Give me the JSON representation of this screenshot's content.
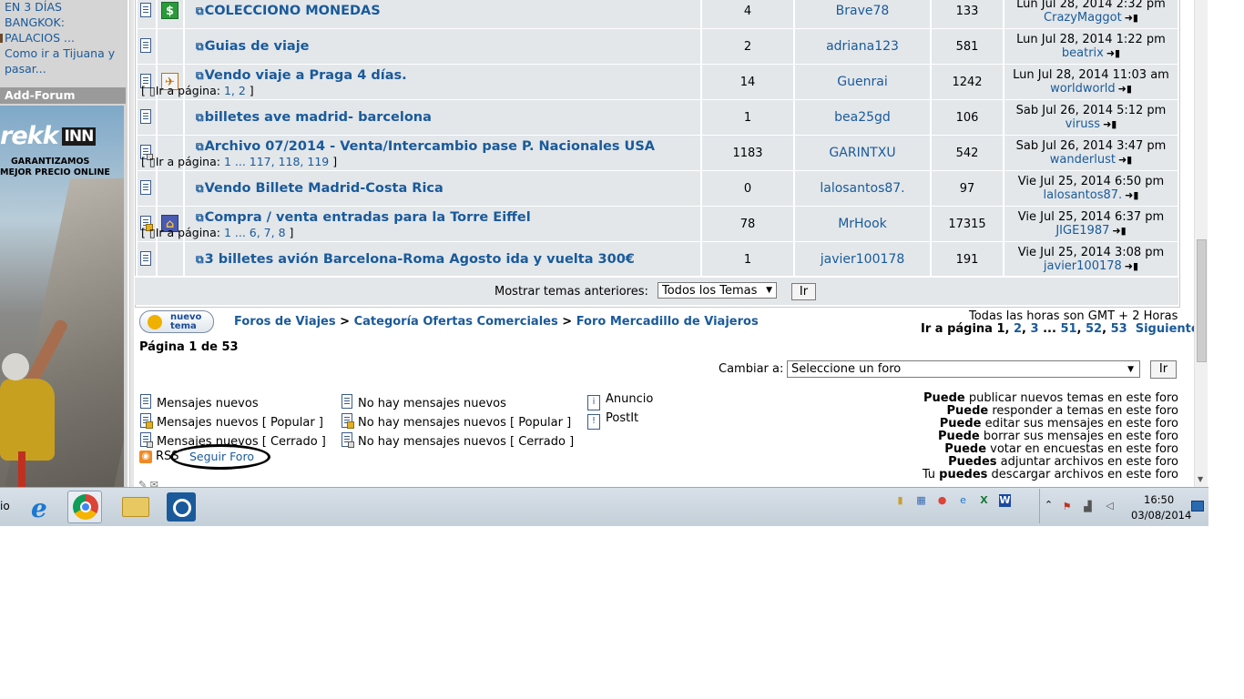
{
  "sidebar": {
    "links": [
      "EN 3 DÍAS",
      "BANGKOK:",
      "PALACIOS ...",
      "Como ir a Tijuana y",
      "pasar..."
    ],
    "section_title": "Add-Forum",
    "ad": {
      "brand": "rekk",
      "brand_box": "INN",
      "line1": "GARANTIZAMOS",
      "line2": "MEJOR PRECIO ONLINE"
    }
  },
  "topics": [
    {
      "title": "COLECCIONO MONEDAS",
      "pages_label": "",
      "pages": "",
      "replies": "4",
      "author": "Brave78",
      "views": "133",
      "last_date": "Lun Jul 28, 2014 2:32 pm",
      "last_user": "CrazyMaggot",
      "type_icon": "dollar-icon",
      "status_icon": "doc-icon"
    },
    {
      "title": "Guias de viaje",
      "pages_label": "",
      "pages": "",
      "replies": "2",
      "author": "adriana123",
      "views": "581",
      "last_date": "Lun Jul 28, 2014 1:22 pm",
      "last_user": "beatrix",
      "type_icon": "",
      "status_icon": "doc-icon"
    },
    {
      "title": "Vendo viaje a Praga 4 días.",
      "pages_label": "Ir a página:",
      "pages": "1, 2",
      "replies": "14",
      "author": "Guenrai",
      "views": "1242",
      "last_date": "Lun Jul 28, 2014 11:03 am",
      "last_user": "worldworld",
      "type_icon": "plane-icon",
      "status_icon": "doc-icon"
    },
    {
      "title": "billetes ave madrid- barcelona",
      "pages_label": "",
      "pages": "",
      "replies": "1",
      "author": "bea25gd",
      "views": "106",
      "last_date": "Sab Jul 26, 2014 5:12 pm",
      "last_user": "viruss",
      "type_icon": "",
      "status_icon": "doc-icon"
    },
    {
      "title": "Archivo 07/2014 - Venta/Intercambio pase P. Nacionales USA",
      "pages_label": "Ir a página:",
      "pages": "1 ... 117, 118, 119",
      "replies": "1183",
      "author": "GARINTXU",
      "views": "542",
      "last_date": "Sab Jul 26, 2014 3:47 pm",
      "last_user": "wanderlust",
      "type_icon": "",
      "status_icon": "doc-locked-icon"
    },
    {
      "title": "Vendo Billete Madrid-Costa Rica",
      "pages_label": "",
      "pages": "",
      "replies": "0",
      "author": "lalosantos87.",
      "views": "97",
      "last_date": "Vie Jul 25, 2014 6:50 pm",
      "last_user": "lalosantos87.",
      "type_icon": "",
      "status_icon": "doc-icon"
    },
    {
      "title": "Compra / venta entradas para la Torre Eiffel",
      "pages_label": "Ir a página:",
      "pages": "1 ... 6, 7, 8",
      "replies": "78",
      "author": "MrHook",
      "views": "17315",
      "last_date": "Vie Jul 25, 2014 6:37 pm",
      "last_user": "JIGE1987",
      "type_icon": "museum-icon",
      "status_icon": "doc-hot-icon"
    },
    {
      "title": "3 billetes avión Barcelona-Roma Agosto ida y vuelta 300€",
      "pages_label": "",
      "pages": "",
      "replies": "1",
      "author": "javier100178",
      "views": "191",
      "last_date": "Vie Jul 25, 2014 3:08 pm",
      "last_user": "javier100178",
      "type_icon": "",
      "status_icon": "doc-icon"
    }
  ],
  "table_footer": {
    "label": "Mostrar temas anteriores:",
    "select_value": "Todos los Temas",
    "button": "Ir"
  },
  "new_topic": {
    "line1": "nuevo",
    "line2": "tema"
  },
  "breadcrumb": {
    "items": [
      "Foros de Viajes",
      "Categoría Ofertas Comerciales",
      "Foro Mercadillo de Viajeros"
    ],
    "separator": ">"
  },
  "timezone": "Todas las horas son GMT + 2 Horas",
  "pagination": {
    "label": "Ir a página",
    "current": "1",
    "pages": [
      "2",
      "3",
      "...",
      "51",
      "52",
      "53"
    ],
    "next": "Siguiente"
  },
  "page_info": "Página 1 de 53",
  "jump": {
    "label": "Cambiar a:",
    "select_value": "Seleccione un foro",
    "button": "Ir"
  },
  "legend": {
    "col1": [
      "Mensajes nuevos",
      "Mensajes nuevos [ Popular ]",
      "Mensajes nuevos [ Cerrado ]"
    ],
    "col2": [
      "No hay mensajes nuevos",
      "No hay mensajes nuevos [ Popular ]",
      "No hay mensajes nuevos [ Cerrado ]"
    ],
    "col3": [
      "Anuncio",
      "PostIt"
    ]
  },
  "permissions": [
    {
      "bold": "Puede",
      "text": " publicar nuevos temas en este foro"
    },
    {
      "bold": "Puede",
      "text": " responder a temas en este foro"
    },
    {
      "bold": "Puede",
      "text": " editar sus mensajes en este foro"
    },
    {
      "bold": "Puede",
      "text": " borrar sus mensajes en este foro"
    },
    {
      "bold": "Puede",
      "text": " votar en encuestas en este foro"
    },
    {
      "bold": "Puedes",
      "text": " adjuntar archivos en este foro"
    },
    {
      "prefix": "Tu ",
      "bold": "puedes",
      "text": " descargar archivos en este foro"
    }
  ],
  "rss": {
    "label": "RSS",
    "follow": "Seguir Foro"
  },
  "taskbar": {
    "start_text": "io",
    "clock_time": "16:50",
    "clock_date": "03/08/2014",
    "pinned": [
      "internet-explorer-icon",
      "chrome-icon",
      "file-explorer-icon",
      "app-icon"
    ]
  },
  "colors": {
    "link": "#1a5a9a",
    "row_bg": "#e3e7ea",
    "oval": "#000000"
  }
}
